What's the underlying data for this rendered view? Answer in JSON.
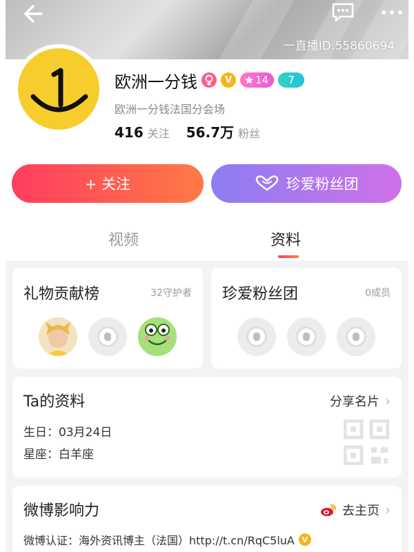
{
  "header": {
    "live_id": "一直播ID:55860694"
  },
  "profile": {
    "name": "欧洲一分钱",
    "level": "14",
    "fan_level": "7",
    "bio": "欧洲一分钱法国分会场",
    "following_count": "416",
    "following_label": "关注",
    "fans_count": "56.7万",
    "fans_label": "粉丝"
  },
  "actions": {
    "follow_label": "+ 关注",
    "fanclub_label": "珍爱粉丝团"
  },
  "tabs": [
    {
      "label": "视频"
    },
    {
      "label": "资料"
    }
  ],
  "gift_board": {
    "title": "礼物贡献榜",
    "meta": "32守护者"
  },
  "fan_club": {
    "title": "珍爱粉丝团",
    "meta": "0成员"
  },
  "ta_profile": {
    "title": "Ta的资料",
    "share_label": "分享名片",
    "birthday": "生日：03月24日",
    "constellation": "星座：白羊座"
  },
  "weibo": {
    "title": "微博影响力",
    "home_label": "去主页",
    "verify_text": "微博认证：海外资讯博主（法国）http://t.cn/RqC5luA"
  },
  "colors": {
    "follow_gradient": [
      "#ff3d5f",
      "#ff7a45"
    ],
    "fanclub_gradient": [
      "#8d7df2",
      "#d071e8"
    ],
    "avatar_yellow": "#f7cd2e"
  }
}
